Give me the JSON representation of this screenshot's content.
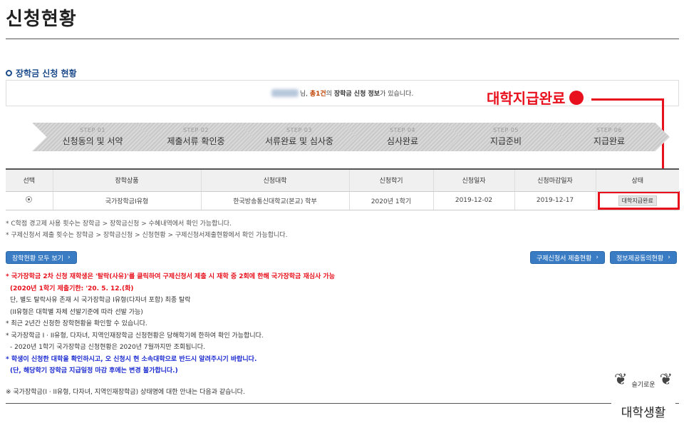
{
  "page_title": "신청현황",
  "section_title": "장학금 신청 현황",
  "info_bar": {
    "name_suffix": "님,",
    "count": "총1건",
    "middle": "의",
    "strong": "장학금 신청 정보",
    "tail": "가 있습니다."
  },
  "annotation": {
    "label": "대학지급완료",
    "color": "#e8101c"
  },
  "steps": [
    {
      "num": "STEP 01",
      "label": "신청동의 및 서약"
    },
    {
      "num": "STEP 02",
      "label": "제출서류 확인중"
    },
    {
      "num": "STEP 03",
      "label": "서류완료 및 심사중"
    },
    {
      "num": "STEP 04",
      "label": "심사완료"
    },
    {
      "num": "STEP 05",
      "label": "지급준비"
    },
    {
      "num": "STEP 06",
      "label": "지급완료"
    }
  ],
  "table": {
    "headers": [
      "선택",
      "장학상품",
      "신청대학",
      "신청학기",
      "신청일자",
      "신청마감일자",
      "상태"
    ],
    "rows": [
      {
        "product": "국가장학금I유형",
        "university": "한국방송통신대학교(본교) 학부",
        "semester": "2020년 1학기",
        "date": "2019-12-02",
        "deadline": "2019-12-17",
        "status": "대학지급완료"
      }
    ]
  },
  "notes": [
    "* C학점 경고제 사용 횟수는 장학금 > 장학금신청 > 수혜내역에서 확인 가능합니다.",
    "* 구제신청서 제출 횟수는 장학금 > 장학금신청 > 신청현황 > 구제신청서제출현황에서 확인 가능합니다."
  ],
  "buttons": {
    "view_all": "장학현황 모두 보기",
    "relief": "구제신청서 제출현황",
    "info_share": "정보제공동의현황"
  },
  "info_list": {
    "line1": "* 국가장학금 2차 신청 재학생은 '탈락(사유)'를 클릭하여 구제신청서 제출 시 재학 중 2회에 한해 국가장학금 재심사 가능",
    "line2": "(2020년 1학기 제출기한: '20. 5. 12.(화)",
    "line3": "단, 별도 탈락사유 존재 시 국가장학금 I유형(다자녀 포함) 최종 탈락",
    "line4": "(II유형은 대학별 자체 선발기준에 따라 선발 가능)",
    "line5": "* 최근 2년간 신청한 장학현황을 확인할 수 있습니다.",
    "line6": "* 국가장학금 I · II유형, 다자녀, 지역인재장학금 신청현황은 당해학기에 한하여 확인 가능합니다.",
    "line7": "- 2020년 1학기 국가장학금 신청현황은 2020년 7월까지만 조회됩니다.",
    "line8": "* 학생이 신청한 대학을 확인하시고, 오 신청시 현 소속대학으로 반드시 알려주시기 바랍니다.",
    "line9": "(단, 해당학기 장학금 지급일정 마감 후에는 변경 불가합니다.)"
  },
  "footer_note": "※ 국가장학금(I · II유형, 다자녀, 지역인재장학금) 상태명에 대한 안내는 다음과 같습니다.",
  "watermark": {
    "small": "슬기로운",
    "big": "대학생활"
  }
}
